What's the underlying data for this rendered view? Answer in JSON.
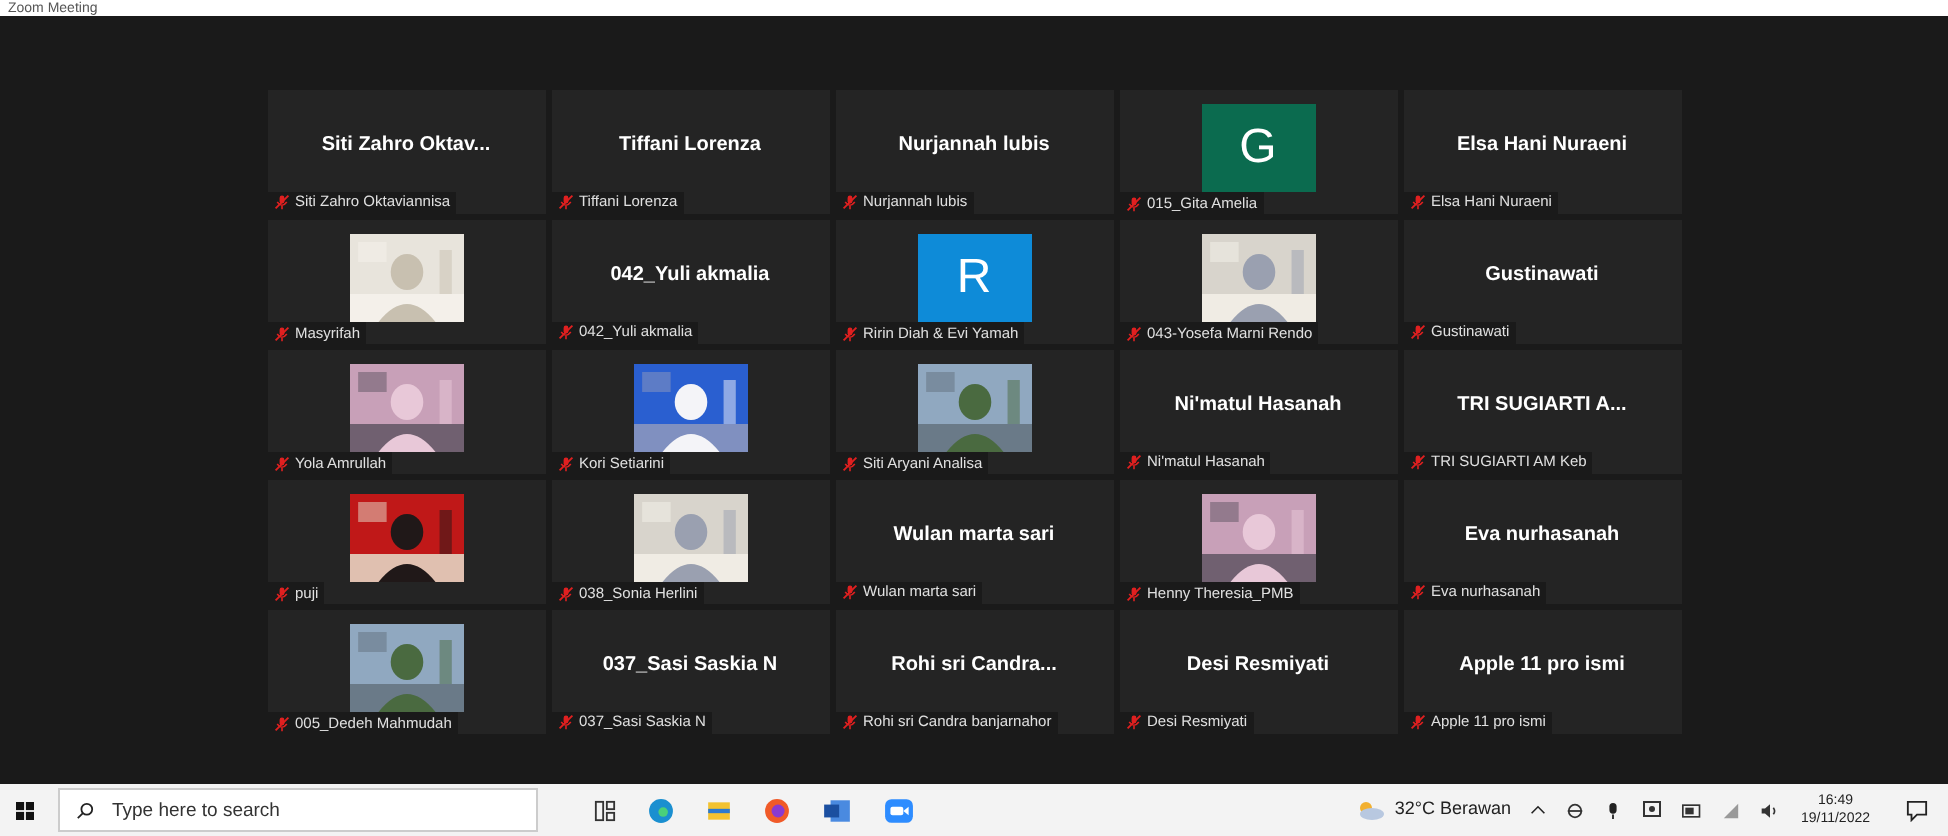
{
  "window": {
    "title": "Zoom Meeting"
  },
  "tiles": [
    {
      "kind": "name",
      "title": "Siti Zahro Oktav...",
      "label": "Siti Zahro Oktaviannisa"
    },
    {
      "kind": "name",
      "title": "Tiffani Lorenza",
      "label": "Tiffani Lorenza"
    },
    {
      "kind": "name",
      "title": "Nurjannah lubis",
      "label": "Nurjannah lubis"
    },
    {
      "kind": "avatar",
      "letter": "G",
      "color": "#0b6b4f",
      "label": "015_Gita Amelia"
    },
    {
      "kind": "name",
      "title": "Elsa Hani Nuraeni",
      "label": "Elsa Hani Nuraeni"
    },
    {
      "kind": "video",
      "label": "Masyrifah"
    },
    {
      "kind": "name",
      "title": "042_Yuli akmalia",
      "label": "042_Yuli akmalia"
    },
    {
      "kind": "avatar",
      "letter": "R",
      "color": "#0e8bd8",
      "label": "Ririn Diah & Evi Yamah"
    },
    {
      "kind": "video",
      "label": "043-Yosefa Marni Rendo"
    },
    {
      "kind": "name",
      "title": "Gustinawati",
      "label": "Gustinawati"
    },
    {
      "kind": "video",
      "label": "Yola Amrullah"
    },
    {
      "kind": "video",
      "label": "Kori Setiarini"
    },
    {
      "kind": "video",
      "label": "Siti Aryani Analisa"
    },
    {
      "kind": "name",
      "title": "Ni'matul Hasanah",
      "label": "Ni'matul Hasanah"
    },
    {
      "kind": "name",
      "title": "TRI SUGIARTI A...",
      "label": "TRI SUGIARTI AM Keb"
    },
    {
      "kind": "video",
      "label": "puji"
    },
    {
      "kind": "video",
      "label": "038_Sonia Herlini"
    },
    {
      "kind": "name",
      "title": "Wulan marta sari",
      "label": "Wulan marta sari"
    },
    {
      "kind": "video",
      "label": "Henny Theresia_PMB"
    },
    {
      "kind": "name",
      "title": "Eva nurhasanah",
      "label": "Eva nurhasanah"
    },
    {
      "kind": "video",
      "label": "005_Dedeh Mahmudah"
    },
    {
      "kind": "name",
      "title": "037_Sasi Saskia N",
      "label": "037_Sasi Saskia N"
    },
    {
      "kind": "name",
      "title": "Rohi sri Candra...",
      "label": "Rohi sri Candra banjarnahor"
    },
    {
      "kind": "name",
      "title": "Desi Resmiyati",
      "label": "Desi Resmiyati"
    },
    {
      "kind": "name",
      "title": "Apple 11 pro ismi",
      "label": "Apple 11 pro ismi"
    }
  ],
  "taskbar": {
    "search": {
      "placeholder": "Type here to search"
    },
    "weather": "32°C Berawan",
    "time": "16:49",
    "date": "19/11/2022"
  }
}
